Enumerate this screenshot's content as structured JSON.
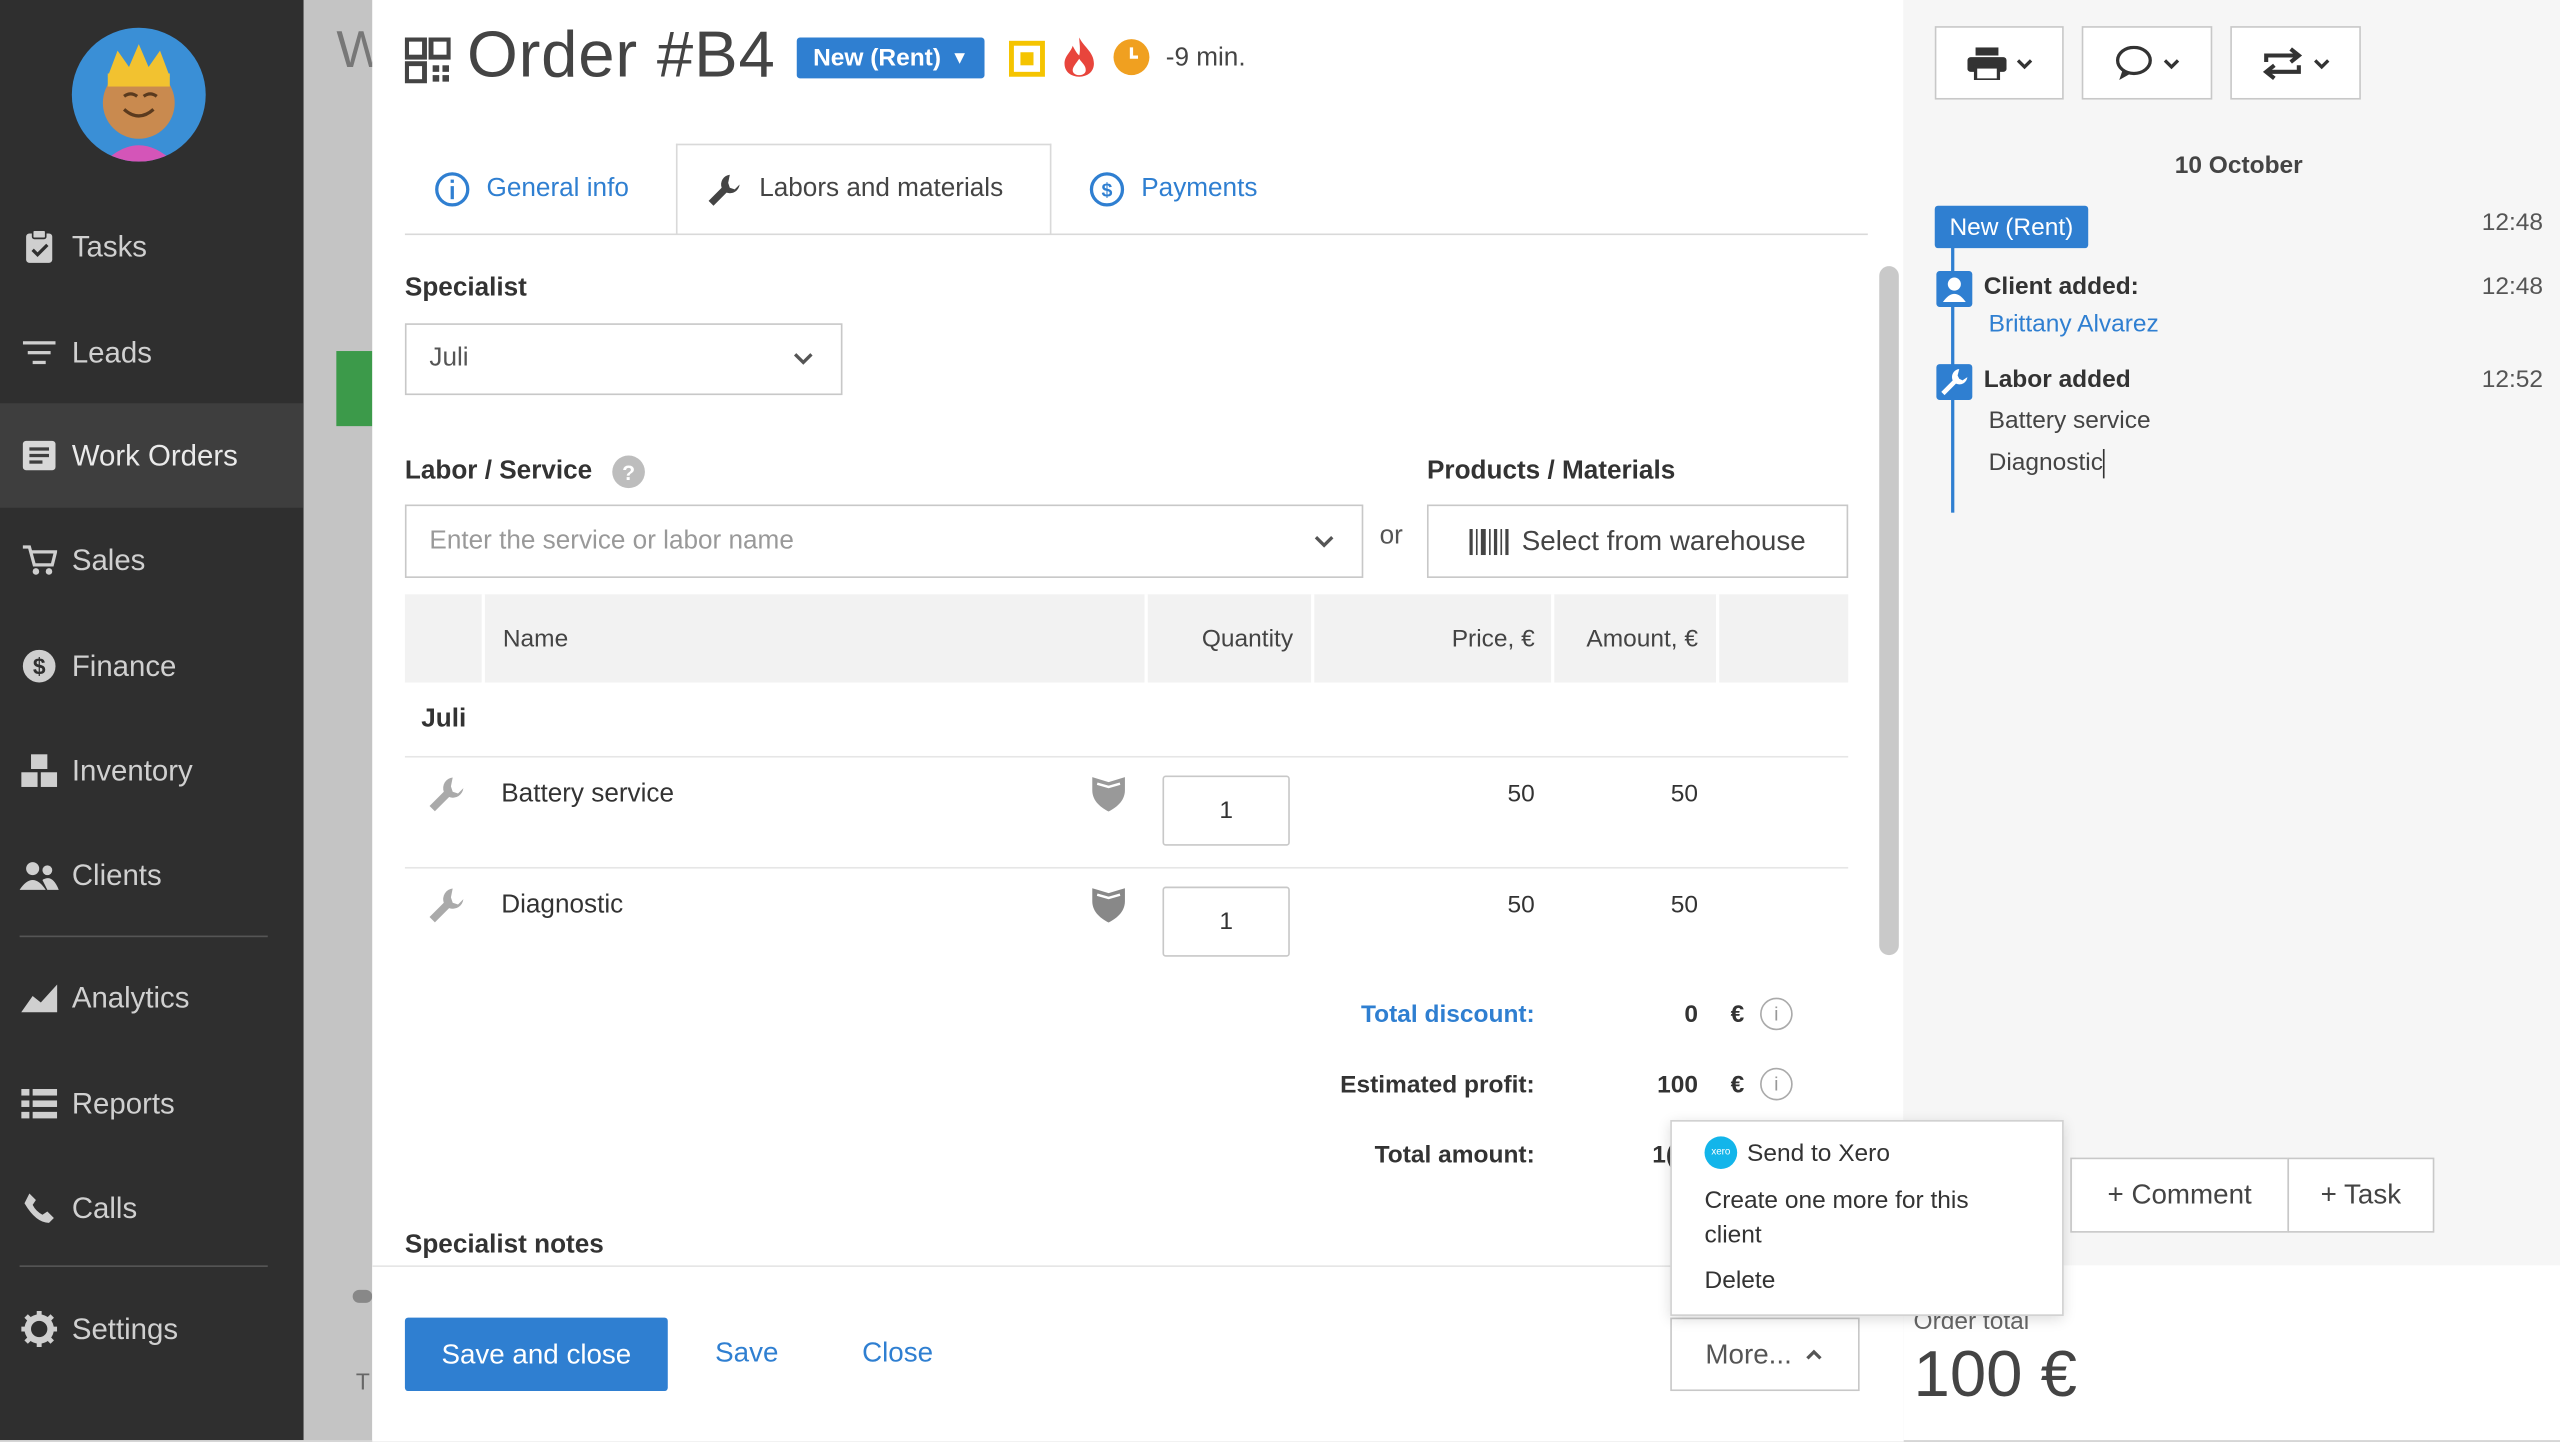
{
  "sidebar": {
    "items": [
      {
        "label": "Tasks",
        "icon": "clipboard-icon"
      },
      {
        "label": "Leads",
        "icon": "filter-icon"
      },
      {
        "label": "Work Orders",
        "icon": "work-orders-icon"
      },
      {
        "label": "Sales",
        "icon": "cart-icon"
      },
      {
        "label": "Finance",
        "icon": "dollar-icon"
      },
      {
        "label": "Inventory",
        "icon": "boxes-icon"
      },
      {
        "label": "Clients",
        "icon": "users-icon"
      },
      {
        "label": "Analytics",
        "icon": "chart-icon"
      },
      {
        "label": "Reports",
        "icon": "list-icon"
      },
      {
        "label": "Calls",
        "icon": "phone-icon"
      },
      {
        "label": "Settings",
        "icon": "gear-icon"
      }
    ],
    "active": "Work Orders"
  },
  "bg_page": {
    "title_fragment": "W",
    "footer_fragment": "T"
  },
  "order": {
    "title": "Order #B4",
    "status": "New (Rent)",
    "timer": "-9 min."
  },
  "tabs": [
    {
      "label": "General info",
      "icon": "info-icon"
    },
    {
      "label": "Labors and materials",
      "icon": "wrench-icon",
      "active": true
    },
    {
      "label": "Payments",
      "icon": "dollar-circle-icon"
    }
  ],
  "form": {
    "specialist_label": "Specialist",
    "specialist_value": "Juli",
    "labor_label": "Labor / Service",
    "labor_placeholder": "Enter the service or labor name",
    "or_text": "or",
    "products_label": "Products / Materials",
    "warehouse_button": "Select from warehouse"
  },
  "table": {
    "headers": {
      "name": "Name",
      "quantity": "Quantity",
      "price": "Price, €",
      "amount": "Amount, €"
    },
    "group": "Juli",
    "rows": [
      {
        "name": "Battery service",
        "quantity": "1",
        "price": "50",
        "amount": "50"
      },
      {
        "name": "Diagnostic",
        "quantity": "1",
        "price": "50",
        "amount": "50"
      }
    ]
  },
  "summary": {
    "discount_label": "Total discount:",
    "discount_value": "0",
    "profit_label": "Estimated profit:",
    "profit_value": "100",
    "total_label": "Total amount:",
    "total_value_partial": "1(",
    "currency": "€"
  },
  "notes_label": "Specialist notes",
  "footer": {
    "save_close": "Save and close",
    "save": "Save",
    "close": "Close",
    "more": "More...",
    "order_total_label": "Order total",
    "order_total_value": "100 €"
  },
  "more_menu": {
    "items": [
      "Send to Xero",
      "Create one more for this client",
      "Delete"
    ]
  },
  "timeline": {
    "date": "10 October",
    "status_badge": "New (Rent)",
    "status_time": "12:48",
    "client_title": "Client added:",
    "client_time": "12:48",
    "client_name": "Brittany Alvarez",
    "labor_title": "Labor added",
    "labor_time": "12:52",
    "labor_items": [
      "Battery service",
      "Diagnostic"
    ]
  },
  "right_actions": {
    "comment": "+ Comment",
    "task": "+ Task"
  },
  "colors": {
    "accent": "#2f7fd1",
    "sidebar": "#2f2f2f",
    "flame": "#e8453c",
    "clock": "#f0a020",
    "badge_yellow": "#f5c400"
  }
}
